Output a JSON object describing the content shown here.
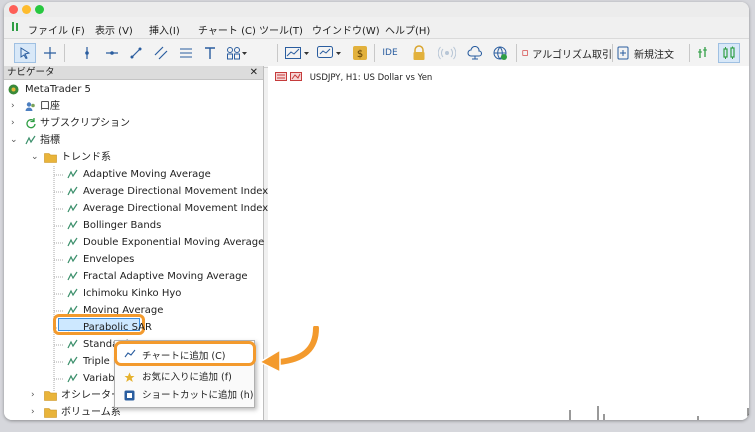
{
  "menu": [
    "ファイル (F)",
    "表示 (V)",
    "挿入(I)",
    "チャート (C)",
    "ツール(T)",
    "ウインドウ(W)",
    "ヘルプ(H)"
  ],
  "toolbar": {
    "ide_label": "IDE",
    "algo_label": "アルゴリズム取引",
    "neworder_label": "新規注文"
  },
  "navigator": {
    "title": "ナビゲータ",
    "close": "✕",
    "root": "MetaTrader 5",
    "accounts": "口座",
    "subscriptions": "サブスクリプション",
    "indicators": "指標",
    "trend_folder": "トレンド系",
    "items": [
      "Adaptive Moving Average",
      "Average Directional Movement Index",
      "Average Directional Movement Index Wi",
      "Bollinger Bands",
      "Double Exponential Moving Average",
      "Envelopes",
      "Fractal Adaptive Moving Average",
      "Ichimoku Kinko Hyo",
      "Moving Average",
      "Parabolic SAR",
      "Standard",
      "Triple E",
      "Variable"
    ],
    "oscillator_folder": "オシレーター",
    "volume_folder": "ボリューム系"
  },
  "chart": {
    "title": "USDJPY, H1:  US Dollar vs Yen"
  },
  "context_menu": [
    "チャートに追加 (C)",
    "お気に入りに追加 (f)",
    "ショートカットに追加 (h)"
  ],
  "colors": {
    "highlight_orange": "#f39a2d",
    "selection_blue": "#cde8ff",
    "indicator_green": "#2f8f5b"
  }
}
